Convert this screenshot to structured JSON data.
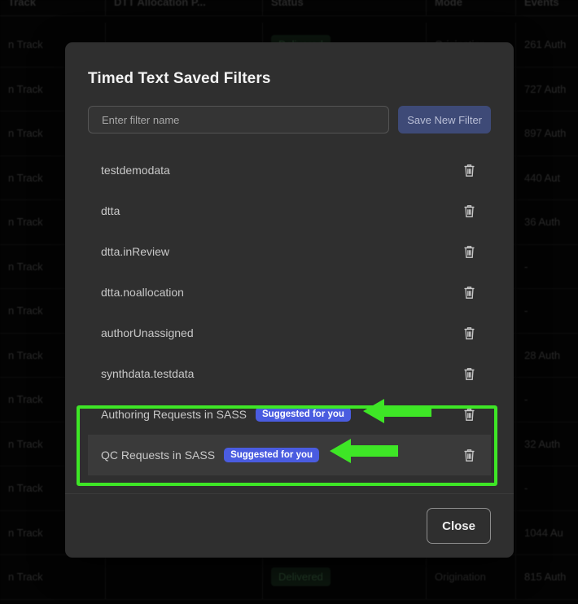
{
  "background_table": {
    "columns": [
      "Track",
      "DTT Allocation P...",
      "Status",
      "Mode",
      "Events"
    ],
    "rows": [
      {
        "track": "n Track",
        "alloc": "",
        "status": "Delivered",
        "mode": "Origination",
        "events": "261 Auth"
      },
      {
        "track": "n Track",
        "alloc": "",
        "status": "",
        "mode": "",
        "events": "727 Auth"
      },
      {
        "track": "n Track",
        "alloc": "",
        "status": "",
        "mode": "",
        "events": "897 Auth"
      },
      {
        "track": "n Track",
        "alloc": "",
        "status": "",
        "mode": "",
        "events": "440 Aut"
      },
      {
        "track": "n Track",
        "alloc": "",
        "status": "",
        "mode": "",
        "events": "36 Auth"
      },
      {
        "track": "n Track",
        "alloc": "",
        "status": "",
        "mode": "",
        "events": "-"
      },
      {
        "track": "n Track",
        "alloc": "",
        "status": "",
        "mode": "",
        "events": "-"
      },
      {
        "track": "n Track",
        "alloc": "",
        "status": "",
        "mode": "",
        "events": "28 Auth"
      },
      {
        "track": "n Track",
        "alloc": "",
        "status": "",
        "mode": "",
        "events": "-"
      },
      {
        "track": "n Track",
        "alloc": "",
        "status": "",
        "mode": "",
        "events": "32 Auth"
      },
      {
        "track": "n Track",
        "alloc": "",
        "status": "",
        "mode": "",
        "events": "-"
      },
      {
        "track": "n Track",
        "alloc": "",
        "status": "",
        "mode": "",
        "events": "1044 Au"
      },
      {
        "track": "n Track",
        "alloc": "",
        "status": "Delivered",
        "mode": "Origination",
        "events": "815 Auth"
      }
    ]
  },
  "modal": {
    "title": "Timed Text Saved Filters",
    "create": {
      "input_value": "",
      "input_placeholder": "Enter filter name",
      "save_button_label": "Save New Filter"
    },
    "filters": [
      {
        "name": "testdemodata",
        "badge": null,
        "hovered": false,
        "highlighted": false
      },
      {
        "name": "dtta",
        "badge": null,
        "hovered": false,
        "highlighted": false
      },
      {
        "name": "dtta.inReview",
        "badge": null,
        "hovered": false,
        "highlighted": false
      },
      {
        "name": "dtta.noallocation",
        "badge": null,
        "hovered": false,
        "highlighted": false
      },
      {
        "name": "authorUnassigned",
        "badge": null,
        "hovered": false,
        "highlighted": false
      },
      {
        "name": "synthdata.testdata",
        "badge": null,
        "hovered": false,
        "highlighted": false
      },
      {
        "name": "Authoring Requests in SASS",
        "badge": "Suggested for you",
        "hovered": false,
        "highlighted": true
      },
      {
        "name": "QC Requests in SASS",
        "badge": "Suggested for you",
        "hovered": true,
        "highlighted": true
      }
    ],
    "delete_icon": "trash-icon",
    "footer": {
      "close_label": "Close"
    }
  },
  "annotations": {
    "highlight_color": "#3ee626",
    "arrows": [
      {
        "target": "Authoring Requests in SASS",
        "direction": "left"
      },
      {
        "target": "QC Requests in SASS",
        "direction": "left"
      }
    ]
  },
  "colors": {
    "modal_bg": "#2f2f2f",
    "badge_blue": "#4a5ce0",
    "save_button_blue": "#3e4a77",
    "delivered_green": "#3f6b46",
    "annotation_green": "#3ee626"
  }
}
